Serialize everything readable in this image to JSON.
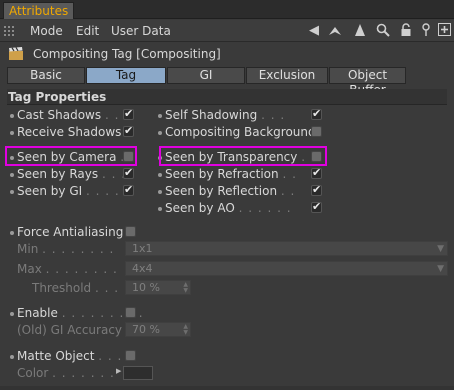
{
  "titlebar": {
    "tab": "Attributes"
  },
  "menu": {
    "mode": "Mode",
    "edit": "Edit",
    "user_data": "User Data"
  },
  "toolbar": {
    "back_icon": "left-arrow-icon",
    "up_icon": "up-arrow-icon",
    "search_icon": "search-icon",
    "lock_icon": "lock-icon",
    "pin_icon": "pin-icon",
    "new_icon": "new-window-icon"
  },
  "object": {
    "title": "Compositing Tag [Compositing]",
    "icon": "clapperboard-icon"
  },
  "tabs": [
    "Basic",
    "Tag",
    "GI",
    "Exclusion",
    "Object Buffer"
  ],
  "section": {
    "title": "Tag Properties"
  },
  "left_props": [
    {
      "label": "Cast Shadows",
      "dots": ". . .",
      "checked": true
    },
    {
      "label": "Receive Shadows",
      "dots": "",
      "checked": true
    },
    {
      "label": "Seen by Camera",
      "dots": ". .",
      "checked": false
    },
    {
      "label": "Seen by Rays",
      "dots": ". . .",
      "checked": true
    },
    {
      "label": "Seen by GI",
      "dots": ". . . .",
      "checked": true
    }
  ],
  "right_props": [
    {
      "label": "Self Shadowing",
      "dots": ". . .",
      "checked": true
    },
    {
      "label": "Compositing Background",
      "dots": "",
      "checked": false
    },
    {
      "label": "Seen by Transparency",
      "dots": ". .",
      "checked": false
    },
    {
      "label": "Seen by Refraction",
      "dots": ". .",
      "checked": true
    },
    {
      "label": "Seen by Reflection",
      "dots": ". .",
      "checked": true
    },
    {
      "label": "Seen by AO",
      "dots": ". . . . . .",
      "checked": true
    }
  ],
  "antialias": {
    "label": "Force Antialiasing",
    "checked": false,
    "min_label": "Min",
    "min_dots": ". . . . . . . .",
    "min_value": "1x1",
    "max_label": "Max",
    "max_dots": ". . . . . . . .",
    "max_value": "4x4",
    "threshold_label": "Threshold",
    "threshold_dots": ". . . . .",
    "threshold_value": "10 %"
  },
  "enable": {
    "label": "Enable",
    "dots": ". . . . . . . . .",
    "checked": false,
    "gi_label": "(Old) GI Accuracy",
    "gi_value": "70 %"
  },
  "matte": {
    "label": "Matte Object",
    "dots": ". . .",
    "checked": false,
    "color_label": "Color",
    "color_dots": ". . . . . . .",
    "color_value": "#2e2e2e"
  }
}
